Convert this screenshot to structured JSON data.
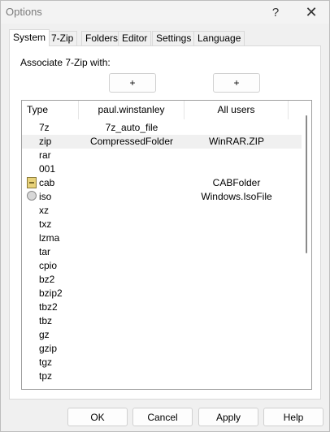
{
  "window": {
    "title": "Options",
    "help_glyph": "?",
    "close_glyph": "✕"
  },
  "tabs": [
    {
      "label": "System",
      "active": true
    },
    {
      "label": "7-Zip"
    },
    {
      "label": "Folders"
    },
    {
      "label": "Editor"
    },
    {
      "label": "Settings"
    },
    {
      "label": "Language"
    }
  ],
  "system": {
    "associate_label": "Associate 7-Zip with:",
    "plus_user_label": "+",
    "plus_all_label": "+",
    "columns": {
      "type": "Type",
      "user": "paul.winstanley",
      "all": "All users"
    },
    "rows": [
      {
        "type": "7z",
        "user": "7z_auto_file",
        "all": "",
        "icon": ""
      },
      {
        "type": "zip",
        "user": "CompressedFolder",
        "all": "WinRAR.ZIP",
        "icon": "",
        "selected": true
      },
      {
        "type": "rar",
        "user": "",
        "all": "",
        "icon": ""
      },
      {
        "type": "001",
        "user": "",
        "all": "",
        "icon": ""
      },
      {
        "type": "cab",
        "user": "",
        "all": "CABFolder",
        "icon": "cabinet-icon"
      },
      {
        "type": "iso",
        "user": "",
        "all": "Windows.IsoFile",
        "icon": "disc-icon"
      },
      {
        "type": "xz",
        "user": "",
        "all": "",
        "icon": ""
      },
      {
        "type": "txz",
        "user": "",
        "all": "",
        "icon": ""
      },
      {
        "type": "lzma",
        "user": "",
        "all": "",
        "icon": ""
      },
      {
        "type": "tar",
        "user": "",
        "all": "",
        "icon": ""
      },
      {
        "type": "cpio",
        "user": "",
        "all": "",
        "icon": ""
      },
      {
        "type": "bz2",
        "user": "",
        "all": "",
        "icon": ""
      },
      {
        "type": "bzip2",
        "user": "",
        "all": "",
        "icon": ""
      },
      {
        "type": "tbz2",
        "user": "",
        "all": "",
        "icon": ""
      },
      {
        "type": "tbz",
        "user": "",
        "all": "",
        "icon": ""
      },
      {
        "type": "gz",
        "user": "",
        "all": "",
        "icon": ""
      },
      {
        "type": "gzip",
        "user": "",
        "all": "",
        "icon": ""
      },
      {
        "type": "tgz",
        "user": "",
        "all": "",
        "icon": ""
      },
      {
        "type": "tpz",
        "user": "",
        "all": "",
        "icon": ""
      }
    ]
  },
  "buttons": {
    "ok": "OK",
    "cancel": "Cancel",
    "apply": "Apply",
    "help": "Help"
  }
}
